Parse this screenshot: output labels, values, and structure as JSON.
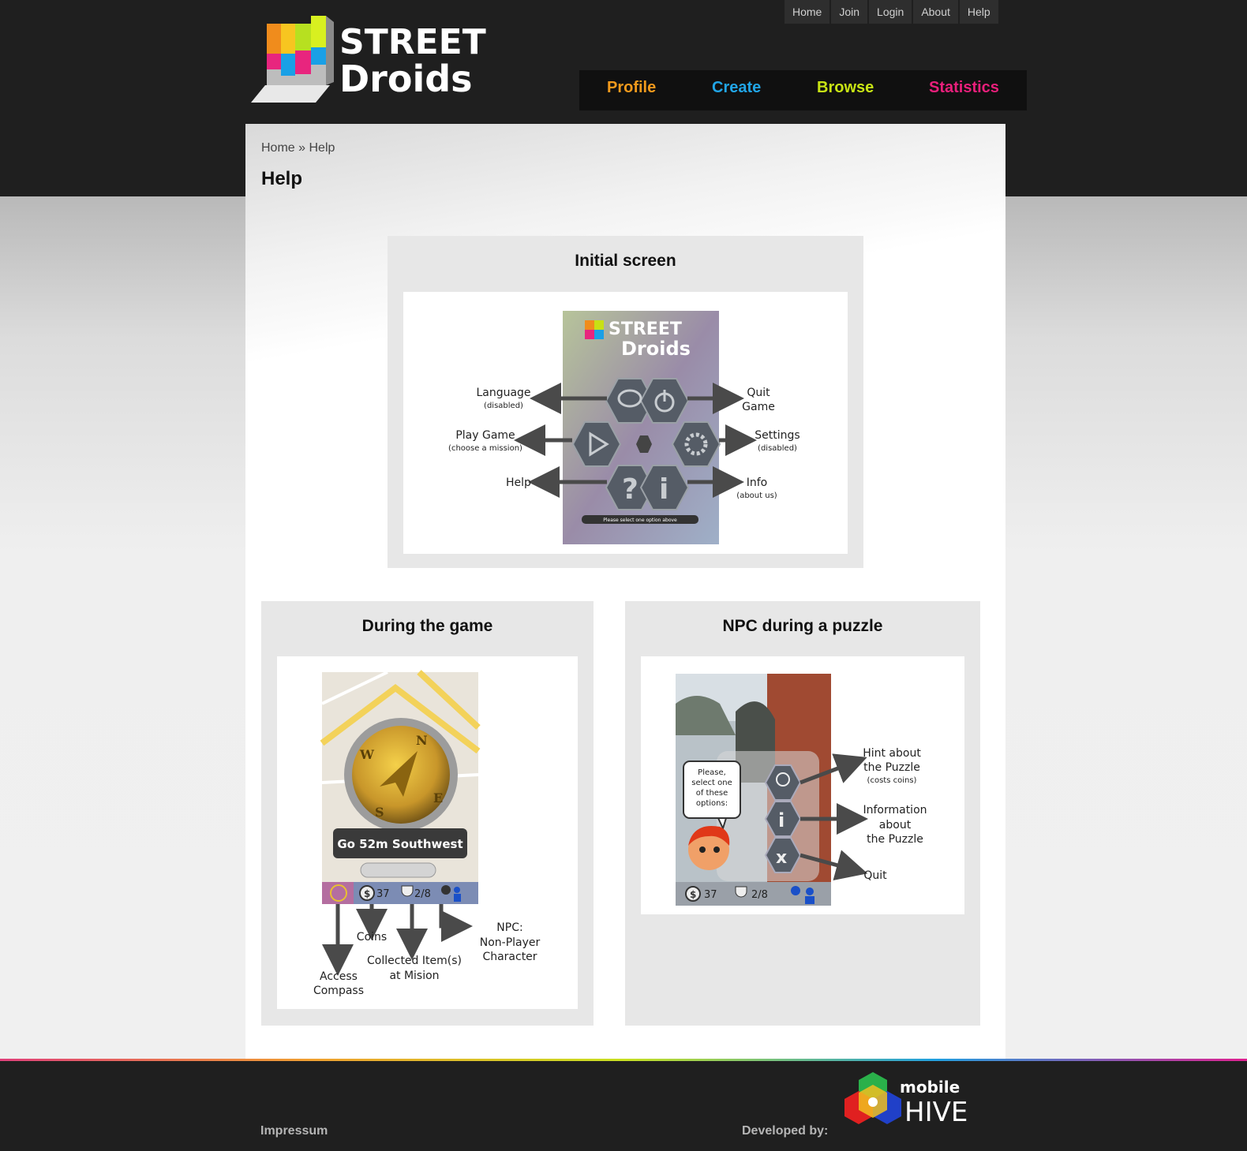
{
  "top_nav": {
    "items": [
      {
        "label": "Home"
      },
      {
        "label": "Join"
      },
      {
        "label": "Login"
      },
      {
        "label": "About"
      },
      {
        "label": "Help"
      }
    ]
  },
  "logo": {
    "line1": "STREET",
    "line2": "Droids"
  },
  "main_nav": {
    "items": [
      {
        "label": "Profile",
        "color": "#f29a1c"
      },
      {
        "label": "Create",
        "color": "#21a5e6"
      },
      {
        "label": "Browse",
        "color": "#c8e414"
      },
      {
        "label": "Statistics",
        "color": "#e81f7b"
      }
    ]
  },
  "breadcrumb": {
    "home": "Home",
    "separator": "»",
    "current": "Help"
  },
  "page_title": "Help",
  "initial_screen": {
    "title": "Initial screen",
    "phone_title_1": "STREET",
    "phone_title_2": "Droids",
    "phone_status": "Please select one option above",
    "labels": {
      "language": "Language",
      "language_note": "(disabled)",
      "quit1": "Quit",
      "quit2": "Game",
      "play": "Play Game",
      "play_note": "(choose a mission)",
      "settings": "Settings",
      "settings_note": "(disabled)",
      "help": "Help",
      "info": "Info",
      "info_note": "(about us)"
    }
  },
  "during_game": {
    "title": "During the game",
    "direction": "Go 52m Southwest",
    "coins": "37",
    "items": "2/8",
    "labels": {
      "coins": "Coins",
      "items1": "Collected Item(s)",
      "items2": "at Mision",
      "compass1": "Access",
      "compass2": "Compass",
      "npc1": "NPC:",
      "npc2": "Non-Player",
      "npc3": "Character"
    }
  },
  "npc_puzzle": {
    "title": "NPC during a puzzle",
    "bubble1": "Please,",
    "bubble2": "select one",
    "bubble3": "of these",
    "bubble4": "options:",
    "coins": "37",
    "items": "2/8",
    "labels": {
      "hint1": "Hint about",
      "hint2": "the Puzzle",
      "hint_note": "(costs coins)",
      "info1": "Information",
      "info2": "about",
      "info3": "the Puzzle",
      "quit": "Quit"
    }
  },
  "footer": {
    "impressum": "Impressum",
    "developed_by": "Developed by:",
    "brand_top": "mobile",
    "brand_bottom": "HIVE"
  }
}
